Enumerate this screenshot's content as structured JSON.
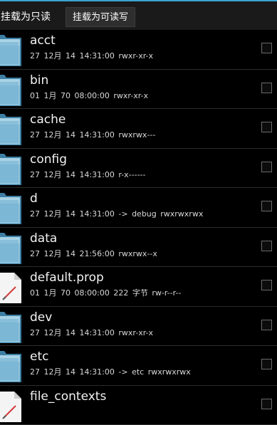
{
  "toolbar": {
    "mount_ro_label": "挂载为只读",
    "mount_rw_label": "挂载为可读写"
  },
  "files": [
    {
      "name": "acct",
      "meta": "27 12月 14 14:31:00   rwxr-xr-x",
      "icon": "folder-icon"
    },
    {
      "name": "bin",
      "meta": "01 1月 70 08:00:00   rwxr-xr-x",
      "icon": "folder-icon"
    },
    {
      "name": "cache",
      "meta": "27 12月 14 14:31:00   rwxrwx---",
      "icon": "folder-icon"
    },
    {
      "name": "config",
      "meta": "27 12月 14 14:31:00   r-x------",
      "icon": "folder-icon"
    },
    {
      "name": "d",
      "meta": "27 12月 14 14:31:00  -> debug  rwxrwxrwx",
      "icon": "folder-icon"
    },
    {
      "name": "data",
      "meta": "27 12月 14 21:56:00   rwxrwx--x",
      "icon": "folder-icon"
    },
    {
      "name": "default.prop",
      "meta": "01 1月 70 08:00:00  222 字节  rw-r--r--",
      "icon": "file-icon"
    },
    {
      "name": "dev",
      "meta": "27 12月 14 14:31:00   rwxr-xr-x",
      "icon": "folder-icon"
    },
    {
      "name": "etc",
      "meta": "27 12月 14 14:31:00  -> etc  rwxrwxrwx",
      "icon": "folder-icon"
    },
    {
      "name": "file_contexts",
      "meta": "",
      "icon": "file-icon"
    }
  ]
}
